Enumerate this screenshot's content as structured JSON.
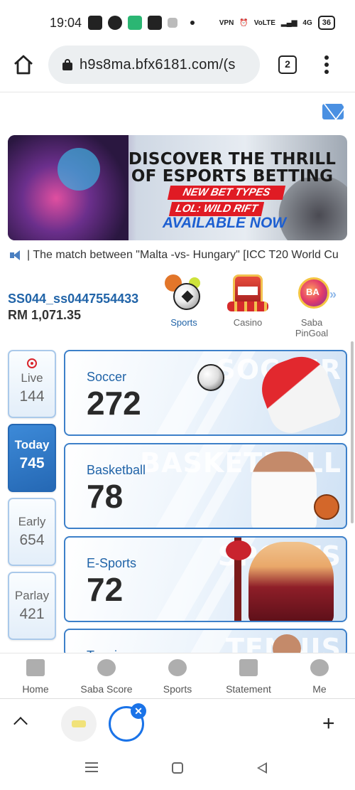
{
  "status_bar": {
    "time": "19:04",
    "battery": "36",
    "network": "4G"
  },
  "browser": {
    "url": "h9s8ma.bfx6181.com/(s",
    "tab_count": "2"
  },
  "banner": {
    "title": "DISCOVER THE THRILL OF ESPORTS BETTING",
    "line1": "NEW BET TYPES",
    "line2": "LOL: WILD RIFT",
    "line3": "AVAILABLE NOW"
  },
  "announcement": "| The match between \"Malta -vs- Hungary\" [ICC T20 World Cu",
  "account": {
    "username": "SS044_ss0447554433",
    "balance": "RM 1,071.35"
  },
  "categories": [
    {
      "label": "Sports",
      "active": true
    },
    {
      "label": "Casino",
      "active": false
    },
    {
      "label": "Saba PinGoal",
      "active": false
    }
  ],
  "time_tabs": [
    {
      "label": "Live",
      "count": "144",
      "active": false
    },
    {
      "label": "Today",
      "count": "745",
      "active": true
    },
    {
      "label": "Early",
      "count": "654",
      "active": false
    },
    {
      "label": "Parlay",
      "count": "421",
      "active": false
    }
  ],
  "sports": [
    {
      "name": "Soccer",
      "count": "272",
      "watermark": "SOCCER"
    },
    {
      "name": "Basketball",
      "count": "78",
      "watermark": "BASKETBALL"
    },
    {
      "name": "E-Sports",
      "count": "72",
      "watermark": "SPORTS"
    },
    {
      "name": "Tennis",
      "count": "",
      "watermark": "TENNIS"
    }
  ],
  "bottom_nav": [
    {
      "label": "Home",
      "icon": "home-icon"
    },
    {
      "label": "Saba Score",
      "icon": "score-icon"
    },
    {
      "label": "Sports",
      "icon": "sports-ball-icon"
    },
    {
      "label": "Statement",
      "icon": "statement-icon"
    },
    {
      "label": "Me",
      "icon": "user-icon"
    }
  ],
  "colors": {
    "accent": "#2164a8",
    "active_tab": "#2568b4",
    "banner_red": "#e01b24",
    "card_border": "#3d80c9"
  }
}
